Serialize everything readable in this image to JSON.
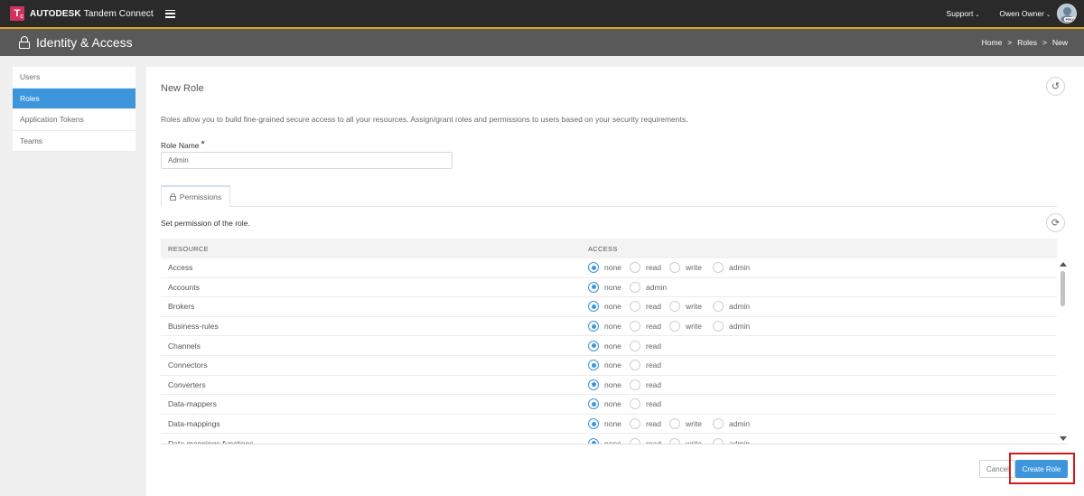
{
  "brand": {
    "logo_letter": "T",
    "logo_sub": "C",
    "company": "AUTODESK",
    "product": "Tandem Connect"
  },
  "topbar": {
    "support_label": "Support",
    "user_label": "Owen Owner",
    "avatar_badge": "PROD"
  },
  "page": {
    "title": "Identity & Access",
    "breadcrumb": [
      "Home",
      ">",
      "Roles",
      ">",
      "New"
    ]
  },
  "sidebar": {
    "items": [
      {
        "label": "Users",
        "active": false
      },
      {
        "label": "Roles",
        "active": true
      },
      {
        "label": "Application Tokens",
        "active": false
      },
      {
        "label": "Teams",
        "active": false
      }
    ]
  },
  "form": {
    "title": "New Role",
    "description": "Roles allow you to build fine-grained secure access to all your resources. Assign/grant roles and permissions to users based on your security requirements.",
    "role_name_label": "Role Name",
    "required_mark": "*",
    "role_name_value": "Admin",
    "tab_label": "Permissions",
    "set_permission_text": "Set permission of the role.",
    "cancel_label": "Cancel",
    "create_label": "Create Role"
  },
  "permissions_table": {
    "headers": [
      "RESOURCE",
      "ACCESS"
    ],
    "rows": [
      {
        "resource": "Access",
        "options": [
          "none",
          "read",
          "write",
          "admin"
        ],
        "selected": "none"
      },
      {
        "resource": "Accounts",
        "options": [
          "none",
          "admin"
        ],
        "selected": "none"
      },
      {
        "resource": "Brokers",
        "options": [
          "none",
          "read",
          "write",
          "admin"
        ],
        "selected": "none"
      },
      {
        "resource": "Business-rules",
        "options": [
          "none",
          "read",
          "write",
          "admin"
        ],
        "selected": "none"
      },
      {
        "resource": "Channels",
        "options": [
          "none",
          "read"
        ],
        "selected": "none"
      },
      {
        "resource": "Connectors",
        "options": [
          "none",
          "read"
        ],
        "selected": "none"
      },
      {
        "resource": "Converters",
        "options": [
          "none",
          "read"
        ],
        "selected": "none"
      },
      {
        "resource": "Data-mappers",
        "options": [
          "none",
          "read"
        ],
        "selected": "none"
      },
      {
        "resource": "Data-mappings",
        "options": [
          "none",
          "read",
          "write",
          "admin"
        ],
        "selected": "none"
      },
      {
        "resource": "Data-mappings-functions",
        "options": [
          "none",
          "read",
          "write",
          "admin"
        ],
        "selected": "none"
      }
    ]
  },
  "colors": {
    "accent": "#3d95dc",
    "topbar": "#2a2a2a",
    "header": "#595959",
    "brand_logo": "#d2335c",
    "highlight": "#d01b1b"
  }
}
